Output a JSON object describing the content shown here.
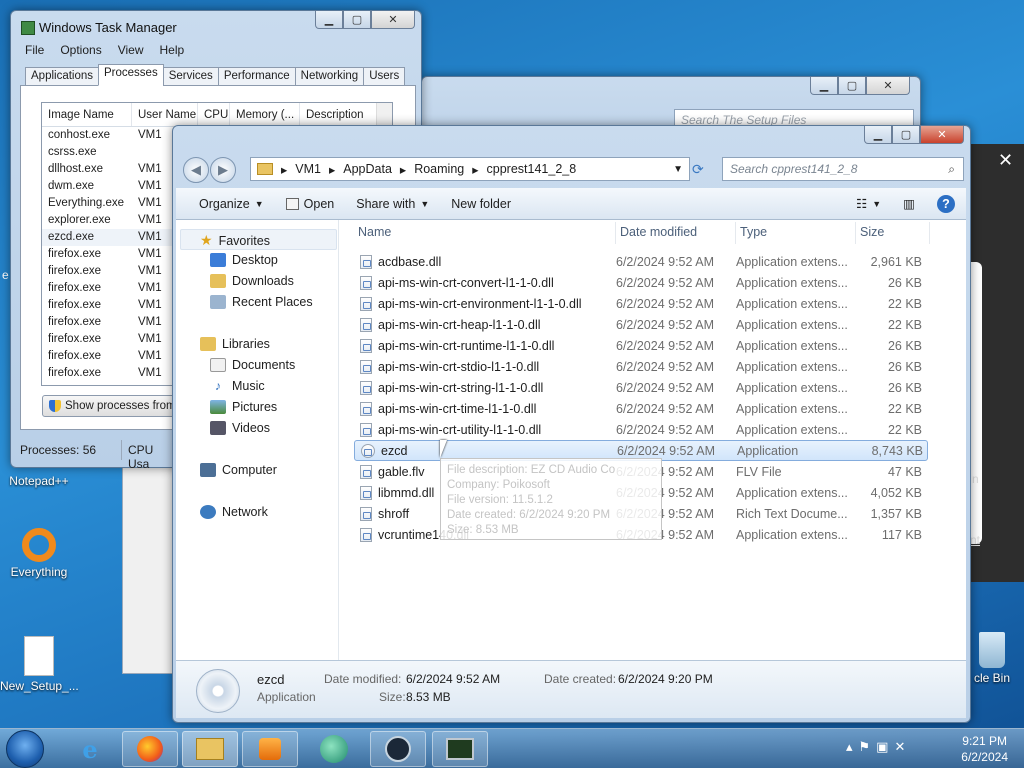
{
  "desktop": {
    "icons": [
      {
        "label": "Notepad++"
      },
      {
        "label": "Everything"
      },
      {
        "label": "New_Setup_..."
      },
      {
        "label": "cle Bin"
      }
    ],
    "edge_texts": {
      "e_letter": "e",
      "n_letter": "n",
      "nt_text": "nt"
    }
  },
  "task_manager": {
    "title": "Windows Task Manager",
    "menu": [
      "File",
      "Options",
      "View",
      "Help"
    ],
    "tabs": [
      "Applications",
      "Processes",
      "Services",
      "Performance",
      "Networking",
      "Users"
    ],
    "active_tab": "Processes",
    "columns": [
      "Image Name",
      "User Name",
      "CPU",
      "Memory (...",
      "Description"
    ],
    "rows": [
      {
        "name": "conhost.exe",
        "user": "VM1"
      },
      {
        "name": "csrss.exe",
        "user": ""
      },
      {
        "name": "dllhost.exe",
        "user": "VM1"
      },
      {
        "name": "dwm.exe",
        "user": "VM1"
      },
      {
        "name": "Everything.exe",
        "user": "VM1"
      },
      {
        "name": "explorer.exe",
        "user": "VM1"
      },
      {
        "name": "ezcd.exe",
        "user": "VM1"
      },
      {
        "name": "firefox.exe",
        "user": "VM1"
      },
      {
        "name": "firefox.exe",
        "user": "VM1"
      },
      {
        "name": "firefox.exe",
        "user": "VM1"
      },
      {
        "name": "firefox.exe",
        "user": "VM1"
      },
      {
        "name": "firefox.exe",
        "user": "VM1"
      },
      {
        "name": "firefox.exe",
        "user": "VM1"
      },
      {
        "name": "firefox.exe",
        "user": "VM1"
      },
      {
        "name": "firefox.exe",
        "user": "VM1"
      }
    ],
    "show_all_button": "Show processes from",
    "status_processes": "Processes: 56",
    "status_cpu": "CPU Usa"
  },
  "back_window": {
    "search_placeholder": "Search The Setup Files"
  },
  "explorer": {
    "breadcrumb": [
      "VM1",
      "AppData",
      "Roaming",
      "cpprest141_2_8"
    ],
    "search_placeholder": "Search cpprest141_2_8",
    "toolbar": {
      "organize": "Organize",
      "open": "Open",
      "share_with": "Share with",
      "new_folder": "New folder"
    },
    "nav": {
      "favorites": "Favorites",
      "desktop": "Desktop",
      "downloads": "Downloads",
      "recent": "Recent Places",
      "libraries": "Libraries",
      "documents": "Documents",
      "music": "Music",
      "pictures": "Pictures",
      "videos": "Videos",
      "computer": "Computer",
      "network": "Network"
    },
    "columns": {
      "name": "Name",
      "date": "Date modified",
      "type": "Type",
      "size": "Size"
    },
    "files": [
      {
        "name": "acdbase.dll",
        "date": "6/2/2024 9:52 AM",
        "type": "Application extens...",
        "size": "2,961 KB"
      },
      {
        "name": "api-ms-win-crt-convert-l1-1-0.dll",
        "date": "6/2/2024 9:52 AM",
        "type": "Application extens...",
        "size": "26 KB"
      },
      {
        "name": "api-ms-win-crt-environment-l1-1-0.dll",
        "date": "6/2/2024 9:52 AM",
        "type": "Application extens...",
        "size": "22 KB"
      },
      {
        "name": "api-ms-win-crt-heap-l1-1-0.dll",
        "date": "6/2/2024 9:52 AM",
        "type": "Application extens...",
        "size": "22 KB"
      },
      {
        "name": "api-ms-win-crt-runtime-l1-1-0.dll",
        "date": "6/2/2024 9:52 AM",
        "type": "Application extens...",
        "size": "26 KB"
      },
      {
        "name": "api-ms-win-crt-stdio-l1-1-0.dll",
        "date": "6/2/2024 9:52 AM",
        "type": "Application extens...",
        "size": "26 KB"
      },
      {
        "name": "api-ms-win-crt-string-l1-1-0.dll",
        "date": "6/2/2024 9:52 AM",
        "type": "Application extens...",
        "size": "26 KB"
      },
      {
        "name": "api-ms-win-crt-time-l1-1-0.dll",
        "date": "6/2/2024 9:52 AM",
        "type": "Application extens...",
        "size": "22 KB"
      },
      {
        "name": "api-ms-win-crt-utility-l1-1-0.dll",
        "date": "6/2/2024 9:52 AM",
        "type": "Application extens...",
        "size": "22 KB"
      },
      {
        "name": "ezcd",
        "date": "6/2/2024 9:52 AM",
        "type": "Application",
        "size": "8,743 KB"
      },
      {
        "name": "gable.flv",
        "date": "6/2/2024 9:52 AM",
        "type": "FLV File",
        "size": "47 KB"
      },
      {
        "name": "libmmd.dll",
        "date": "6/2/2024 9:52 AM",
        "type": "Application extens...",
        "size": "4,052 KB"
      },
      {
        "name": "shroff",
        "date": "6/2/2024 9:52 AM",
        "type": "Rich Text Docume...",
        "size": "1,357 KB"
      },
      {
        "name": "vcruntime140.dll",
        "date": "6/2/2024 9:52 AM",
        "type": "Application extens...",
        "size": "117 KB"
      }
    ],
    "tooltip_lines": [
      "File description: EZ CD Audio Co",
      "Company: Poikosoft",
      "File version: 11.5.1.2",
      "Date created: 6/2/2024 9:20 PM",
      "Size: 8.53 MB"
    ],
    "details": {
      "name": "ezcd",
      "type": "Application",
      "date_modified_label": "Date modified:",
      "date_modified": "6/2/2024 9:52 AM",
      "date_created_label": "Date created:",
      "date_created": "6/2/2024 9:20 PM",
      "size_label": "Size:",
      "size": "8.53 MB"
    }
  },
  "taskbar": {
    "time": "9:21 PM",
    "date": "6/2/2024"
  },
  "colors": {
    "accent": "#3a78c2",
    "selection": "#d1e5fb",
    "close": "#c9412c"
  }
}
